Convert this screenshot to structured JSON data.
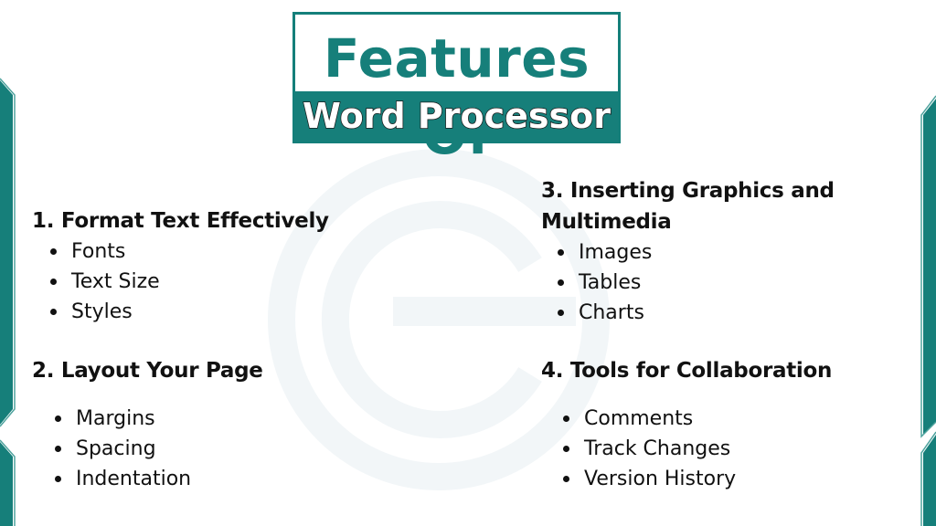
{
  "title": {
    "line1": "Features Of",
    "line2": "Word Processor"
  },
  "colors": {
    "accent": "#167f7a",
    "text": "#111111",
    "background": "#ffffff",
    "watermark": "#f2f6f8"
  },
  "sections": [
    {
      "heading": "1. Format Text Effectively",
      "items": [
        "Fonts",
        "Text Size",
        "Styles"
      ]
    },
    {
      "heading": "2. Layout Your Page",
      "items": [
        "Margins",
        "Spacing",
        "Indentation"
      ]
    },
    {
      "heading": "3. Inserting Graphics and Multimedia",
      "items": [
        "Images",
        "Tables",
        "Charts"
      ]
    },
    {
      "heading": "4. Tools for Collaboration",
      "items": [
        "Comments",
        "Track Changes",
        "Version History"
      ]
    }
  ],
  "decorations": {
    "side_bands": "teal-chevron-bands",
    "watermark_icon": "e-logo-icon"
  }
}
